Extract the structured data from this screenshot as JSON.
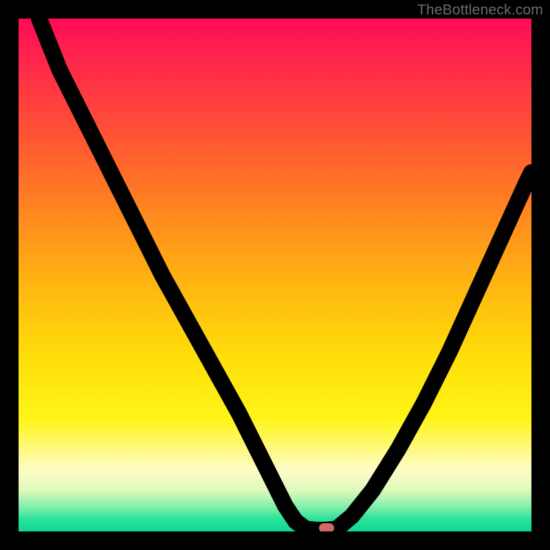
{
  "attribution": "TheBottleneck.com",
  "colors": {
    "frame": "#000000",
    "curve": "#000000",
    "marker": "#d06a60",
    "gradient_stops": [
      "#ff0b57",
      "#ff2c48",
      "#ff5732",
      "#ff881f",
      "#ffb611",
      "#ffde0a",
      "#fff417",
      "#fefcc8",
      "#dff9bb",
      "#7aedaa",
      "#2de29a",
      "#0fd898"
    ]
  },
  "chart_data": {
    "type": "line",
    "title": "",
    "xlabel": "",
    "ylabel": "",
    "xlim": [
      0,
      100
    ],
    "ylim": [
      0,
      100
    ],
    "note": "No axis ticks or labels visible; values are read as percentages of the plot box (0 = bottom/left, 100 = top/right).",
    "series": [
      {
        "name": "left-branch",
        "x": [
          4,
          8,
          13,
          18,
          23,
          28,
          33,
          38,
          43,
          47,
          50,
          52,
          54,
          56
        ],
        "y": [
          100,
          90,
          80,
          70,
          60,
          50,
          41,
          32,
          23,
          15,
          9,
          5,
          2,
          0.5
        ]
      },
      {
        "name": "valley-floor",
        "x": [
          56,
          58,
          60,
          62
        ],
        "y": [
          0.5,
          0.3,
          0.3,
          0.5
        ]
      },
      {
        "name": "right-branch",
        "x": [
          62,
          65,
          69,
          74,
          79,
          84,
          89,
          94,
          99,
          100
        ],
        "y": [
          0.5,
          3,
          8,
          16,
          25,
          35,
          46,
          57,
          68,
          70
        ]
      }
    ],
    "marker": {
      "x": 60,
      "y": 0.7,
      "label": ""
    },
    "background_gradient_axis": "y",
    "background_gradient_meaning": "heat scale from high (top, red) to low (bottom, green) — no numeric scale shown"
  }
}
